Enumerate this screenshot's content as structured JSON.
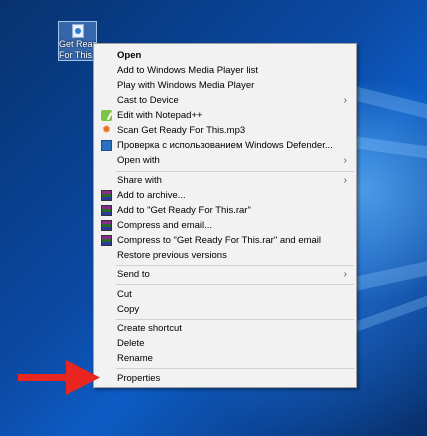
{
  "desktop_icon": {
    "label_line1": "Get Ready",
    "label_line2": "For This.r"
  },
  "menu": {
    "items": [
      {
        "label": "Open",
        "bold": true
      },
      {
        "label": "Add to Windows Media Player list"
      },
      {
        "label": "Play with Windows Media Player"
      },
      {
        "label": "Cast to Device",
        "submenu": true
      },
      {
        "label": "Edit with Notepad++",
        "icon": "notepad-plus-icon"
      },
      {
        "label": "Scan Get Ready For This.mp3",
        "icon": "avast-scan-icon"
      },
      {
        "label": "Проверка с использованием Windows Defender...",
        "icon": "windows-defender-icon"
      },
      {
        "label": "Open with",
        "submenu": true
      },
      {
        "label": "Share with",
        "submenu": true
      },
      {
        "label": "Add to archive...",
        "icon": "winrar-icon"
      },
      {
        "label": "Add to \"Get Ready For This.rar\"",
        "icon": "winrar-icon"
      },
      {
        "label": "Compress and email...",
        "icon": "winrar-icon"
      },
      {
        "label": "Compress to \"Get Ready For This.rar\" and email",
        "icon": "winrar-icon"
      },
      {
        "label": "Restore previous versions"
      },
      {
        "label": "Send to",
        "submenu": true
      },
      {
        "label": "Cut"
      },
      {
        "label": "Copy"
      },
      {
        "label": "Create shortcut"
      },
      {
        "label": "Delete"
      },
      {
        "label": "Rename"
      },
      {
        "label": "Properties"
      }
    ],
    "submenu_glyph": "›"
  },
  "colors": {
    "arrow": "#e8261f",
    "menu_bg": "#f2f2f2",
    "desktop": "#0b4aa5"
  }
}
